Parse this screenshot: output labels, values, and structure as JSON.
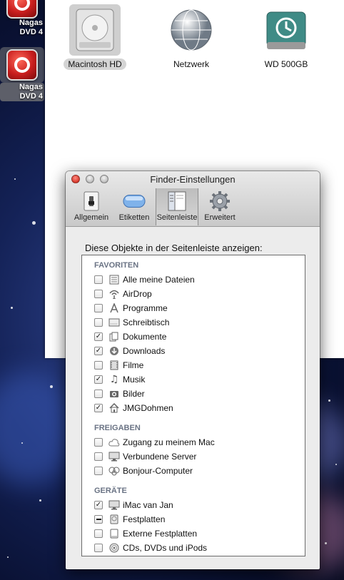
{
  "desktop": {
    "icons": [
      {
        "label": "Nagas\nDVD 4",
        "selected": false
      },
      {
        "label": "Nagas\nDVD 4",
        "selected": true
      }
    ]
  },
  "finder": {
    "volumes": [
      {
        "label": "Macintosh HD",
        "icon": "hard-drive-icon",
        "selected": true
      },
      {
        "label": "Netzwerk",
        "icon": "network-globe-icon",
        "selected": false
      },
      {
        "label": "WD 500GB",
        "icon": "time-machine-drive-icon",
        "selected": false
      }
    ]
  },
  "prefs": {
    "title": "Finder-Einstellungen",
    "toolbar": [
      {
        "label": "Allgemein",
        "icon": "switch-icon",
        "active": false
      },
      {
        "label": "Etiketten",
        "icon": "label-icon",
        "active": false
      },
      {
        "label": "Seitenleiste",
        "icon": "sidebar-icon",
        "active": true
      },
      {
        "label": "Erweitert",
        "icon": "gear-icon",
        "active": false
      }
    ],
    "heading": "Diese Objekte in der Seitenleiste anzeigen:",
    "groups": [
      {
        "title": "FAVORITEN",
        "items": [
          {
            "label": "Alle meine Dateien",
            "state": "unchecked",
            "icon": "all-files-icon"
          },
          {
            "label": "AirDrop",
            "state": "unchecked",
            "icon": "airdrop-icon"
          },
          {
            "label": "Programme",
            "state": "unchecked",
            "icon": "applications-icon"
          },
          {
            "label": "Schreibtisch",
            "state": "unchecked",
            "icon": "desktop-icon"
          },
          {
            "label": "Dokumente",
            "state": "checked",
            "icon": "documents-icon"
          },
          {
            "label": "Downloads",
            "state": "checked",
            "icon": "downloads-icon"
          },
          {
            "label": "Filme",
            "state": "unchecked",
            "icon": "movies-icon"
          },
          {
            "label": "Musik",
            "state": "checked",
            "icon": "music-icon"
          },
          {
            "label": "Bilder",
            "state": "unchecked",
            "icon": "pictures-icon"
          },
          {
            "label": "JMGDohmen",
            "state": "checked",
            "icon": "home-icon"
          }
        ]
      },
      {
        "title": "FREIGABEN",
        "items": [
          {
            "label": "Zugang zu meinem Mac",
            "state": "unchecked",
            "icon": "cloud-icon"
          },
          {
            "label": "Verbundene Server",
            "state": "unchecked",
            "icon": "server-icon"
          },
          {
            "label": "Bonjour-Computer",
            "state": "unchecked",
            "icon": "bonjour-icon"
          }
        ]
      },
      {
        "title": "GERÄTE",
        "items": [
          {
            "label": "iMac van Jan",
            "state": "checked",
            "icon": "imac-icon"
          },
          {
            "label": "Festplatten",
            "state": "mixed",
            "icon": "harddisk-icon"
          },
          {
            "label": "Externe Festplatten",
            "state": "unchecked",
            "icon": "external-disk-icon"
          },
          {
            "label": "CDs, DVDs und iPods",
            "state": "unchecked",
            "icon": "disc-icon"
          }
        ]
      }
    ]
  }
}
